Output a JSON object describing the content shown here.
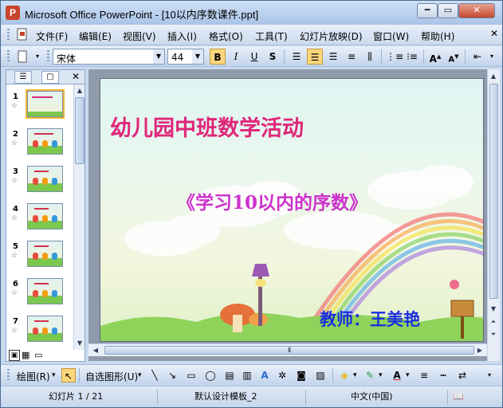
{
  "window": {
    "title": "Microsoft Office PowerPoint - [10以内序数课件.ppt]",
    "app_icon": "P"
  },
  "menu": {
    "items": [
      "文件(F)",
      "编辑(E)",
      "视图(V)",
      "插入(I)",
      "格式(O)",
      "工具(T)",
      "幻灯片放映(D)",
      "窗口(W)",
      "帮助(H)"
    ]
  },
  "format_toolbar": {
    "font_name": "宋体",
    "font_size": "44"
  },
  "side_pane": {
    "slides": [
      "1",
      "2",
      "3",
      "4",
      "5",
      "6",
      "7"
    ]
  },
  "slide": {
    "title": "幼儿园中班数学活动",
    "subtitle": "《学习10以内的序数》",
    "teacher": "教师：王美艳"
  },
  "drawing_toolbar": {
    "draw_label": "绘图(R)",
    "autoshapes_label": "自选图形(U)"
  },
  "status": {
    "slide_info": "幻灯片 1 / 21",
    "design": "默认设计模板_2",
    "language": "中文(中国)"
  },
  "colors": {
    "title_pink": "#e0267a",
    "subtitle_magenta": "#cc33cc",
    "teacher_blue": "#1a2ee0"
  }
}
